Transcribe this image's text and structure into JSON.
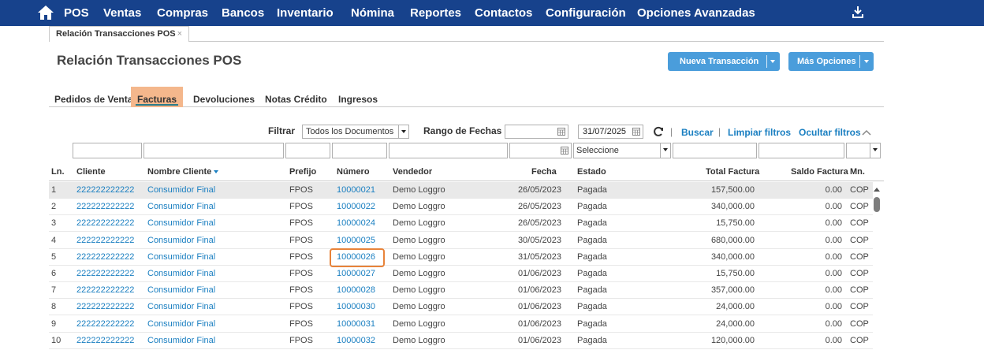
{
  "nav": {
    "items": [
      "POS",
      "Ventas",
      "Compras",
      "Bancos",
      "Inventario",
      "Nómina",
      "Reportes",
      "Contactos",
      "Configuración",
      "Opciones Avanzadas"
    ]
  },
  "doc_tab": {
    "label": "Relación Transacciones POS",
    "close": "×"
  },
  "page_title": "Relación Transacciones POS",
  "buttons": {
    "new_transaction": "Nueva Transacción",
    "more_options": "Más Opciones"
  },
  "subtabs": [
    "Pedidos de Venta",
    "Facturas",
    "Devoluciones",
    "Notas Crédito",
    "Ingresos"
  ],
  "active_subtab": "Facturas",
  "filter": {
    "label": "Filtrar",
    "document_select": "Todos los Documentos",
    "date_range_label": "Rango de Fechas",
    "date_from": "",
    "date_to": "31/07/2025",
    "search": "Buscar",
    "clear_filters": "Limpiar filtros",
    "hide_filters": "Ocultar filtros",
    "separator": "|"
  },
  "column_filters": {
    "estado_placeholder": "Seleccione"
  },
  "table": {
    "headers": {
      "ln": "Ln.",
      "cliente": "Cliente",
      "nombre_cliente": "Nombre Cliente",
      "prefijo": "Prefijo",
      "numero": "Número",
      "vendedor": "Vendedor",
      "fecha": "Fecha",
      "estado": "Estado",
      "total_factura": "Total Factura",
      "saldo_factura": "Saldo Factura",
      "mn": "Mn."
    },
    "rows": [
      {
        "ln": "1",
        "cliente": "222222222222",
        "nombre": "Consumidor Final",
        "prefijo": "FPOS",
        "numero": "10000021",
        "vendedor": "Demo Loggro",
        "fecha": "26/05/2023",
        "estado": "Pagada",
        "total": "157,500.00",
        "saldo": "0.00",
        "mn": "COP"
      },
      {
        "ln": "2",
        "cliente": "222222222222",
        "nombre": "Consumidor Final",
        "prefijo": "FPOS",
        "numero": "10000022",
        "vendedor": "Demo Loggro",
        "fecha": "26/05/2023",
        "estado": "Pagada",
        "total": "340,000.00",
        "saldo": "0.00",
        "mn": "COP"
      },
      {
        "ln": "3",
        "cliente": "222222222222",
        "nombre": "Consumidor Final",
        "prefijo": "FPOS",
        "numero": "10000024",
        "vendedor": "Demo Loggro",
        "fecha": "26/05/2023",
        "estado": "Pagada",
        "total": "15,750.00",
        "saldo": "0.00",
        "mn": "COP"
      },
      {
        "ln": "4",
        "cliente": "222222222222",
        "nombre": "Consumidor Final",
        "prefijo": "FPOS",
        "numero": "10000025",
        "vendedor": "Demo Loggro",
        "fecha": "30/05/2023",
        "estado": "Pagada",
        "total": "680,000.00",
        "saldo": "0.00",
        "mn": "COP"
      },
      {
        "ln": "5",
        "cliente": "222222222222",
        "nombre": "Consumidor Final",
        "prefijo": "FPOS",
        "numero": "10000026",
        "vendedor": "Demo Loggro",
        "fecha": "31/05/2023",
        "estado": "Pagada",
        "total": "340,000.00",
        "saldo": "0.00",
        "mn": "COP"
      },
      {
        "ln": "6",
        "cliente": "222222222222",
        "nombre": "Consumidor Final",
        "prefijo": "FPOS",
        "numero": "10000027",
        "vendedor": "Demo Loggro",
        "fecha": "01/06/2023",
        "estado": "Pagada",
        "total": "15,750.00",
        "saldo": "0.00",
        "mn": "COP"
      },
      {
        "ln": "7",
        "cliente": "222222222222",
        "nombre": "Consumidor Final",
        "prefijo": "FPOS",
        "numero": "10000028",
        "vendedor": "Demo Loggro",
        "fecha": "01/06/2023",
        "estado": "Pagada",
        "total": "357,000.00",
        "saldo": "0.00",
        "mn": "COP"
      },
      {
        "ln": "8",
        "cliente": "222222222222",
        "nombre": "Consumidor Final",
        "prefijo": "FPOS",
        "numero": "10000030",
        "vendedor": "Demo Loggro",
        "fecha": "01/06/2023",
        "estado": "Pagada",
        "total": "24,000.00",
        "saldo": "0.00",
        "mn": "COP"
      },
      {
        "ln": "9",
        "cliente": "222222222222",
        "nombre": "Consumidor Final",
        "prefijo": "FPOS",
        "numero": "10000031",
        "vendedor": "Demo Loggro",
        "fecha": "01/06/2023",
        "estado": "Pagada",
        "total": "24,000.00",
        "saldo": "0.00",
        "mn": "COP"
      },
      {
        "ln": "10",
        "cliente": "222222222222",
        "nombre": "Consumidor Final",
        "prefijo": "FPOS",
        "numero": "10000032",
        "vendedor": "Demo Loggro",
        "fecha": "01/06/2023",
        "estado": "Pagada",
        "total": "120,000.00",
        "saldo": "0.00",
        "mn": "COP"
      }
    ]
  },
  "colors": {
    "nav_bg": "#17428c",
    "accent_blue": "#4a9ddb",
    "link": "#1a7fc1",
    "active_tab_bg": "#f4b78c",
    "highlight": "#e8833a",
    "selected_row": "#e9e9e9"
  }
}
